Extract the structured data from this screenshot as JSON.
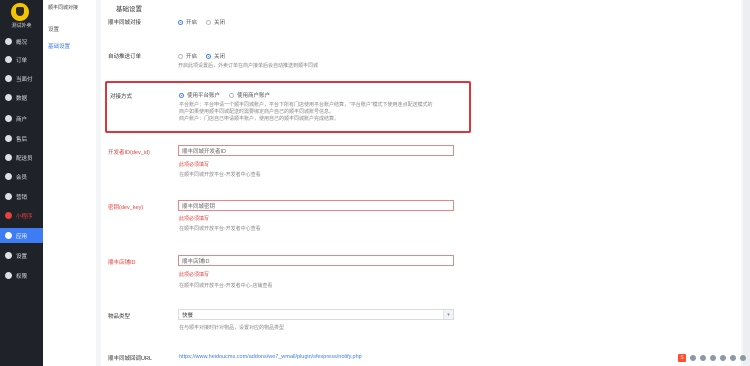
{
  "sidebar": {
    "store_name": "测试外卖",
    "items": [
      {
        "label": "概况",
        "icon": "dashboard-icon"
      },
      {
        "label": "订单",
        "icon": "order-icon"
      },
      {
        "label": "当面付",
        "icon": "pay-icon"
      },
      {
        "label": "数据",
        "icon": "data-icon"
      },
      {
        "label": "商户",
        "icon": "merchant-icon"
      },
      {
        "label": "售后",
        "icon": "aftersale-icon"
      },
      {
        "label": "配送员",
        "icon": "courier-icon"
      },
      {
        "label": "会员",
        "icon": "member-icon"
      },
      {
        "label": "营销",
        "icon": "marketing-icon"
      },
      {
        "label": "小程序",
        "icon": "miniprogram-icon"
      },
      {
        "label": "应用",
        "icon": "apps-icon"
      },
      {
        "label": "设置",
        "icon": "settings-icon"
      },
      {
        "label": "权限",
        "icon": "permission-icon"
      }
    ]
  },
  "subside": {
    "title": "顺丰同城对接",
    "items": [
      "设置",
      "基础设置"
    ]
  },
  "main": {
    "section_title": "基础设置",
    "sf_connect": {
      "label": "顺丰同城对接",
      "options": [
        "开启",
        "关闭"
      ],
      "selected": "开启"
    },
    "auto_push": {
      "label": "自动推送订单",
      "options": [
        "开启",
        "关闭"
      ],
      "selected": "关闭",
      "hint": "开启此项设置后，外卖订单在商户接单后会自动推送到顺丰同城"
    },
    "connect_mode": {
      "label": "对接方式",
      "options": [
        "使用平台账户",
        "使用商户账户"
      ],
      "selected": "使用平台账户",
      "hint_line1": "平台账户：平台申请一个顺丰同城账户，平台下所有门店使用平台账户结算，\"平台账户\"模式下使用连点配送模式的",
      "hint_line2": "商户如果使用顺丰同城配送时需要绑定商户自己的顺丰同城账号信息。",
      "hint_line3": "商户账户：门店自己申请顺丰账户，使用自己的顺丰同城账户完成结算。"
    },
    "dev_id": {
      "label": "开发者ID(dev_id)",
      "placeholder": "顺丰同城开发者ID",
      "error": "此项必须填写",
      "hint": "在顺丰同城开放平台-开发者中心查看"
    },
    "dev_key": {
      "label": "密钥(dev_key)",
      "placeholder": "顺丰同城密钥",
      "error": "此项必须填写",
      "hint": "在顺丰同城开放平台-开发者中心查看"
    },
    "shop_id": {
      "label": "顺丰店铺ID",
      "placeholder": "顺丰店铺ID",
      "error": "此项必须填写",
      "hint": "在顺丰同城开放平台-开发者中心-店铺查看"
    },
    "goods_type": {
      "label": "物品类型",
      "value": "快餐",
      "hint": "在与顺丰对接时针对物品，设置对应的物品类型"
    },
    "callback": {
      "label": "顺丰同城回调URL",
      "url": "https://www.heidoucms.com/addons/we7_wmall/plugin/sfexpress/notify.php"
    }
  },
  "tray": {
    "brand": "S"
  }
}
